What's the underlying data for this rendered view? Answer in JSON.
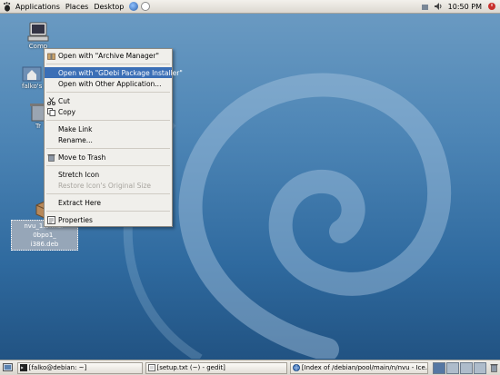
{
  "top_panel": {
    "menus": [
      "Applications",
      "Places",
      "Desktop"
    ],
    "clock": "10:50 PM"
  },
  "desktop_icons": {
    "computer": "Comp",
    "home": "falko's",
    "trash": "Tr",
    "deb_file_line1": "nvu_1.0final-0bpo1_",
    "deb_file_line2": "i386.deb"
  },
  "context_menu": {
    "items": [
      {
        "label": "Open with \"Archive Manager\"",
        "icon": "archive-icon"
      },
      {
        "label": "Open with \"GDebi Package Installer\"",
        "selected": true
      },
      {
        "label": "Open with Other Application..."
      },
      {
        "label": "Cut",
        "icon": "scissors-icon"
      },
      {
        "label": "Copy",
        "icon": "copy-icon"
      },
      {
        "label": "Make Link"
      },
      {
        "label": "Rename..."
      },
      {
        "label": "Move to Trash",
        "icon": "trash-icon"
      },
      {
        "label": "Stretch Icon"
      },
      {
        "label": "Restore Icon's Original Size",
        "disabled": true
      },
      {
        "label": "Extract Here"
      },
      {
        "label": "Properties",
        "icon": "properties-icon"
      }
    ]
  },
  "taskbar": {
    "tasks": [
      {
        "label": "[falko@debian: ~]",
        "icon": "terminal-icon"
      },
      {
        "label": "[setup.txt (~) - gedit]",
        "icon": "text-editor-icon"
      },
      {
        "label": "[Index of /debian/pool/main/n/nvu - Ice...",
        "icon": "browser-icon"
      }
    ],
    "workspaces": 4,
    "active_workspace": 1
  },
  "colors": {
    "desktop": "#4e86b6",
    "menu_selection": "#3b6fb6",
    "panel": "#e6e3dd"
  }
}
